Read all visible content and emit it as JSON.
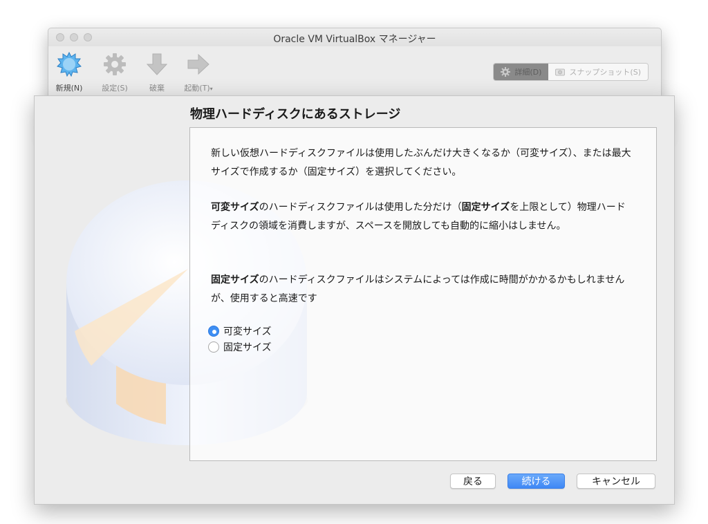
{
  "window": {
    "title": "Oracle VM VirtualBox マネージャー"
  },
  "toolbar": {
    "new": "新規(N)",
    "settings": "設定(S)",
    "discard": "破棄",
    "start": "起動(T)",
    "start_suffix": "▾",
    "details": "詳細(D)",
    "snapshots": "スナップショット(S)"
  },
  "wizard": {
    "heading": "物理ハードディスクにあるストレージ",
    "p1": "新しい仮想ハードディスクファイルは使用したぶんだけ大きくなるか（可変サイズ）、または最大サイズで作成するか（固定サイズ）を選択してください。",
    "p2_bold1": "可変サイズ",
    "p2_text1": "のハードディスクファイルは使用した分だけ（",
    "p2_bold2": "固定サイズ",
    "p2_text2": "を上限として）物理ハードディスクの領域を消費しますが、スペースを開放しても自動的に縮小はしません。",
    "p3_bold": "固定サイズ",
    "p3_text": "のハードディスクファイルはシステムによっては作成に時間がかかるかもしれませんが、使用すると高速です",
    "options": [
      {
        "label": "可変サイズ",
        "selected": true
      },
      {
        "label": "固定サイズ",
        "selected": false
      }
    ],
    "back": "戻る",
    "continue": "続ける",
    "cancel": "キャンセル"
  },
  "colors": {
    "accent": "#3f88f5",
    "radio_selected": "#3e8ef3"
  }
}
